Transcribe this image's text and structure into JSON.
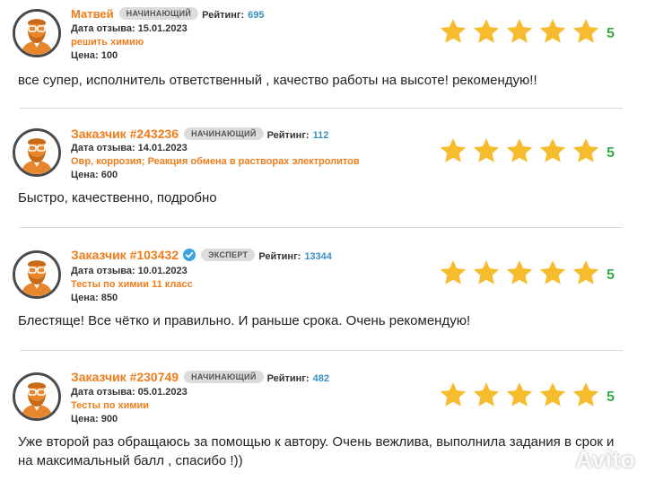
{
  "reviews": [
    {
      "name": "Матвей",
      "badge": "начинающий",
      "verified": false,
      "rating_label": "Рейтинг:",
      "rating": "695",
      "date": "Дата отзыва: 15.01.2023",
      "subject": "решить химию",
      "price": "Цена: 100",
      "score": "5",
      "text": "все супер, исполнитель ответственный , качество работы на высоте! рекомендую!!"
    },
    {
      "name": "Заказчик #243236",
      "badge": "начинающий",
      "verified": false,
      "rating_label": "Рейтинг:",
      "rating": "112",
      "date": "Дата отзыва: 14.01.2023",
      "subject": "Овр, коррозия; Реакция обмена в растворах электролитов",
      "price": "Цена: 600",
      "score": "5",
      "text": "Быстро, качественно, подробно"
    },
    {
      "name": "Заказчик #103432",
      "badge": "эксперт",
      "verified": true,
      "rating_label": "Рейтинг:",
      "rating": "13344",
      "date": "Дата отзыва: 10.01.2023",
      "subject": "Тесты по химии 11 класс",
      "price": "Цена: 850",
      "score": "5",
      "text": "Блестяще! Все чётко и правильно. И раньше срока. Очень рекомендую!"
    },
    {
      "name": "Заказчик #230749",
      "badge": "начинающий",
      "verified": false,
      "rating_label": "Рейтинг:",
      "rating": "482",
      "date": "Дата отзыва: 05.01.2023",
      "subject": "Тесты по химии",
      "price": "Цена: 900",
      "score": "5",
      "text": "Уже второй раз обращаюсь за помощью к автору. Очень вежлива, выполнила задания в срок и на максимальный балл , спасибо !))"
    }
  ],
  "star_count": 5,
  "watermark": "Avito",
  "colors": {
    "accent": "#f07d1a",
    "star": "#f7bb2e",
    "score": "#3aa84a",
    "rating": "#3a8fc5",
    "badge_bg": "#dcdcdc"
  }
}
